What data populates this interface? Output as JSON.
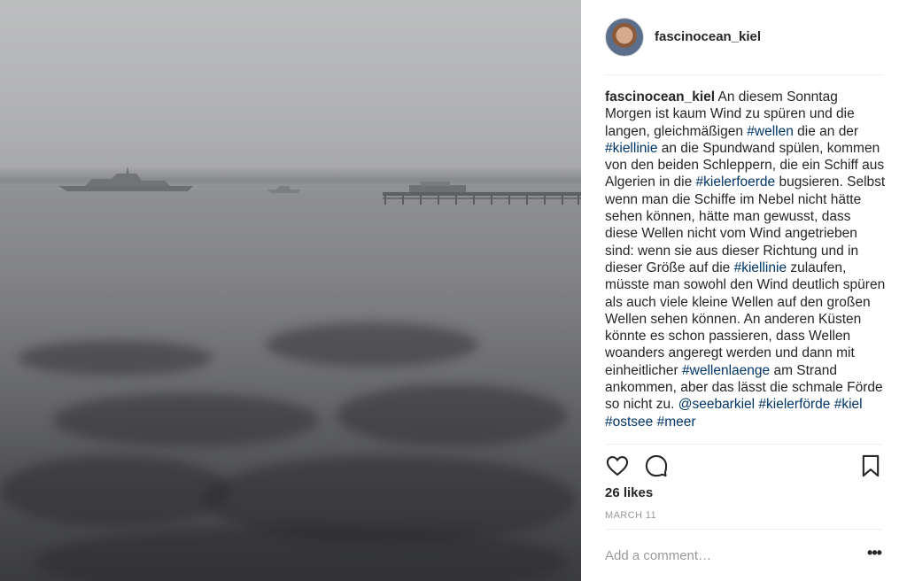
{
  "post": {
    "username": "fascinocean_kiel",
    "caption": [
      {
        "text": "fascinocean_kiel",
        "type": "user"
      },
      {
        "text": " An diesem Sonntag Morgen ist kaum Wind zu spüren und die langen, gleichmäßigen ",
        "type": "text"
      },
      {
        "text": "#wellen",
        "type": "tag"
      },
      {
        "text": " die an der ",
        "type": "text"
      },
      {
        "text": "#kiellinie",
        "type": "tag"
      },
      {
        "text": " an die Spundwand spülen, kommen von den beiden Schleppern, die ein Schiff aus Algerien in die ",
        "type": "text"
      },
      {
        "text": "#kielerfoerde",
        "type": "tag"
      },
      {
        "text": " bugsieren. Selbst wenn man die Schiffe im Nebel nicht hätte sehen können, hätte man gewusst, dass diese Wellen nicht vom Wind angetrieben sind: wenn sie aus dieser Richtung und in dieser Größe auf die ",
        "type": "text"
      },
      {
        "text": "#kiellinie",
        "type": "tag"
      },
      {
        "text": " zulaufen, müsste man sowohl den Wind deutlich spüren als auch viele kleine Wellen auf den großen Wellen sehen können. An anderen Küsten könnte es schon passieren, dass Wellen woanders angeregt werden und dann mit einheitlicher ",
        "type": "text"
      },
      {
        "text": "#wellenlaenge",
        "type": "tag"
      },
      {
        "text": " am Strand ankommen, aber das lässt die schmale Förde so nicht zu. ",
        "type": "text"
      },
      {
        "text": "@seebarkiel",
        "type": "tag"
      },
      {
        "text": " ",
        "type": "text"
      },
      {
        "text": "#kielerförde",
        "type": "tag"
      },
      {
        "text": " ",
        "type": "text"
      },
      {
        "text": "#kiel",
        "type": "tag"
      },
      {
        "text": " ",
        "type": "text"
      },
      {
        "text": "#ostsee",
        "type": "tag"
      },
      {
        "text": " ",
        "type": "text"
      },
      {
        "text": "#meer",
        "type": "tag"
      }
    ],
    "likes": "26 likes",
    "date": "MARCH 11",
    "comment_placeholder": "Add a comment…",
    "more_label": "•••",
    "icons": {
      "like": "heart-icon",
      "comment": "comment-bubble-icon",
      "save": "bookmark-icon",
      "more": "ellipsis-icon"
    }
  }
}
